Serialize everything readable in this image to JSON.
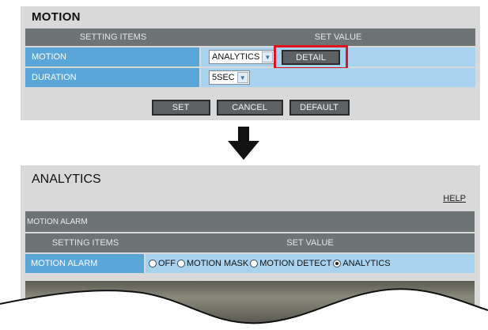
{
  "motion_panel": {
    "title": "MOTION",
    "header": {
      "items": "SETTING ITEMS",
      "value": "SET VALUE"
    },
    "rows": [
      {
        "label": "MOTION",
        "select_value": "ANALYTICS",
        "detail_button": "DETAIL"
      },
      {
        "label": "DURATION",
        "select_value": "5SEC"
      }
    ],
    "buttons": {
      "set": "SET",
      "cancel": "CANCEL",
      "default": "DEFAULT"
    }
  },
  "analytics_panel": {
    "title": "ANALYTICS",
    "help": "HELP",
    "section_title": "MOTION ALARM",
    "header": {
      "items": "SETTING ITEMS",
      "value": "SET VALUE"
    },
    "row": {
      "label": "MOTION ALARM",
      "options": [
        "OFF",
        "MOTION MASK",
        "MOTION DETECT",
        "ANALYTICS"
      ],
      "selected": "ANALYTICS"
    }
  },
  "colors": {
    "header_bar": "#6e7476",
    "label_cell": "#5aa6d9",
    "value_cell": "#a9d2ef",
    "highlight": "#e0141c",
    "panel_bg": "#d9d9d9"
  },
  "icons": [
    "dropdown-arrow-icon",
    "down-arrow-icon",
    "radio-icon"
  ]
}
